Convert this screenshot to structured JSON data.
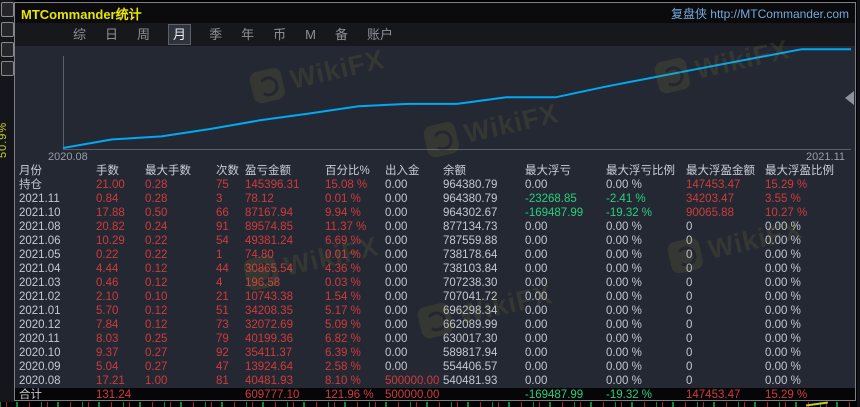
{
  "window": {
    "title": "MTCommander统计",
    "brand": "复盘侠 http://MTCommander.com"
  },
  "left_strip": {
    "vertical_label": "50.9%"
  },
  "menu": {
    "items": [
      {
        "label": "综",
        "active": false
      },
      {
        "label": "日",
        "active": false
      },
      {
        "label": "周",
        "active": false
      },
      {
        "label": "月",
        "active": true
      },
      {
        "label": "季",
        "active": false
      },
      {
        "label": "年",
        "active": false
      },
      {
        "label": "币",
        "active": false
      },
      {
        "label": "M",
        "active": false
      },
      {
        "label": "备",
        "active": false
      },
      {
        "label": "账户",
        "active": false
      }
    ]
  },
  "watermark": {
    "text": "WikiFX"
  },
  "chart_data": {
    "type": "line",
    "title": "",
    "xlabel": "",
    "ylabel": "",
    "x_start_label": "2020.08",
    "x_end_label": "2021.11",
    "x": [
      "2020.08",
      "2020.09",
      "2020.10",
      "2020.11",
      "2020.12",
      "2021.01",
      "2021.02",
      "2021.03",
      "2021.04",
      "2021.05",
      "2021.06",
      "2021.08",
      "2021.10",
      "2021.11"
    ],
    "values": [
      540481.93,
      554406.57,
      589817.94,
      630017.3,
      662089.99,
      696298.34,
      707041.72,
      707238.3,
      738103.84,
      738178.64,
      787559.88,
      877134.73,
      964302.67,
      964380.79
    ],
    "start_value": 500000,
    "ylim": [
      500000,
      970000
    ],
    "line_color": "#00a9f4",
    "grid": false,
    "legend": "none"
  },
  "table": {
    "headers": [
      "月份",
      "手数",
      "最大手数",
      "次数",
      "盈亏金额",
      "百分比%",
      "出入金",
      "余额",
      "最大浮亏",
      "最大浮亏比例",
      "最大浮盈金额",
      "最大浮盈比例"
    ],
    "rows": [
      [
        "持仓",
        "21.00",
        "0.28",
        "75",
        "145396.31",
        "15.08 %",
        "0.00",
        "964380.79",
        "0.00",
        "0.00 %",
        "147453.47",
        "15.29 %"
      ],
      [
        "2021.11",
        "0.84",
        "0.28",
        "3",
        "78.12",
        "0.01 %",
        "0.00",
        "964380.79",
        "-23268.85",
        "-2.41 %",
        "34203.47",
        "3.55 %"
      ],
      [
        "2021.10",
        "17.88",
        "0.50",
        "66",
        "87167.94",
        "9.94 %",
        "0.00",
        "964302.67",
        "-169487.99",
        "-19.32 %",
        "90065.88",
        "10.27 %"
      ],
      [
        "2021.08",
        "20.82",
        "0.24",
        "91",
        "89574.85",
        "11.37 %",
        "0.00",
        "877134.73",
        "0.00",
        "0.00 %",
        "0",
        "0.00 %"
      ],
      [
        "2021.06",
        "10.29",
        "0.22",
        "54",
        "49381.24",
        "6.69 %",
        "0.00",
        "787559.88",
        "0.00",
        "0.00 %",
        "0",
        "0.00 %"
      ],
      [
        "2021.05",
        "0.22",
        "0.22",
        "1",
        "74.80",
        "0.01 %",
        "0.00",
        "738178.64",
        "0.00",
        "0.00 %",
        "0",
        "0.00 %"
      ],
      [
        "2021.04",
        "4.44",
        "0.12",
        "44",
        "30865.54",
        "4.36 %",
        "0.00",
        "738103.84",
        "0.00",
        "0.00 %",
        "0",
        "0.00 %"
      ],
      [
        "2021.03",
        "0.46",
        "0.12",
        "4",
        "196.58",
        "0.03 %",
        "0.00",
        "707238.30",
        "0.00",
        "0.00 %",
        "0",
        "0.00 %"
      ],
      [
        "2021.02",
        "2.10",
        "0.10",
        "21",
        "10743.38",
        "1.54 %",
        "0.00",
        "707041.72",
        "0.00",
        "0.00 %",
        "0",
        "0.00 %"
      ],
      [
        "2021.01",
        "5.70",
        "0.12",
        "51",
        "34208.35",
        "5.17 %",
        "0.00",
        "696298.34",
        "0.00",
        "0.00 %",
        "0",
        "0.00 %"
      ],
      [
        "2020.12",
        "7.84",
        "0.12",
        "73",
        "32072.69",
        "5.09 %",
        "0.00",
        "662089.99",
        "0.00",
        "0.00 %",
        "0",
        "0.00 %"
      ],
      [
        "2020.11",
        "8.03",
        "0.25",
        "79",
        "40199.36",
        "6.82 %",
        "0.00",
        "630017.30",
        "0.00",
        "0.00 %",
        "0",
        "0.00 %"
      ],
      [
        "2020.10",
        "9.37",
        "0.27",
        "92",
        "35411.37",
        "6.39 %",
        "0.00",
        "589817.94",
        "0.00",
        "0.00 %",
        "0",
        "0.00 %"
      ],
      [
        "2020.09",
        "5.04",
        "0.27",
        "47",
        "13924.64",
        "2.58 %",
        "0.00",
        "554406.57",
        "0.00",
        "0.00 %",
        "0",
        "0.00 %"
      ],
      [
        "2020.08",
        "17.21",
        "1.00",
        "81",
        "40481.93",
        "8.10 %",
        "500000.00",
        "540481.93",
        "0.00",
        "0.00 %",
        "0",
        "0.00 %"
      ]
    ],
    "total_row": [
      "合计",
      "131.24",
      "",
      "",
      "609777.10",
      "121.96 %",
      "500000.00",
      "",
      "-169487.99",
      "-19.32 %",
      "147453.47",
      "15.29 %"
    ]
  },
  "colors": {
    "accent_line": "#00a9f4",
    "profit_red": "#d13b3b",
    "drawdown_green": "#27d07d",
    "title_yellow": "#e8e600",
    "brand_blue": "#74aadd"
  }
}
